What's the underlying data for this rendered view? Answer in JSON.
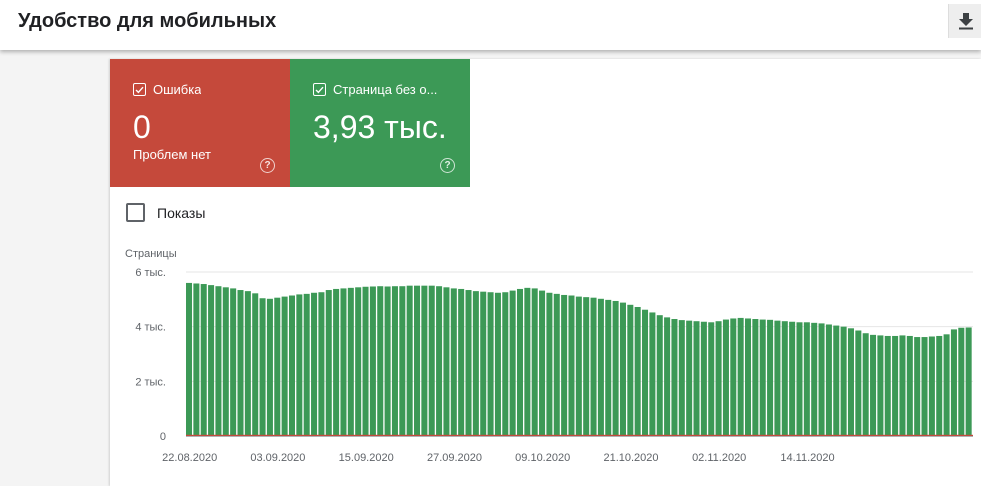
{
  "header": {
    "title": "Удобство для мобильных",
    "download_icon": "download-icon"
  },
  "tiles": {
    "error": {
      "label": "Ошибка",
      "value": "0",
      "sub": "Проблем нет",
      "color": "#c5493b",
      "checked": true
    },
    "valid": {
      "label": "Страница без о...",
      "value": "3,93 тыс.",
      "color": "#3c9956",
      "checked": true
    }
  },
  "impressions": {
    "label": "Показы",
    "checked": false
  },
  "chart_data": {
    "type": "bar",
    "ylabel": "Страницы",
    "ylim": [
      0,
      6000
    ],
    "yticks": [
      "0",
      "2 тыс.",
      "4 тыс.",
      "6 тыс."
    ],
    "ytick_values": [
      0,
      2000,
      4000,
      6000
    ],
    "xtick_labels": [
      "22.08.2020",
      "03.09.2020",
      "15.09.2020",
      "27.09.2020",
      "09.10.2020",
      "21.10.2020",
      "02.11.2020",
      "14.11.2020"
    ],
    "x_start": "22.08.2020",
    "grid": true,
    "series": [
      {
        "color": "#3c9956",
        "values": [
          5600,
          5580,
          5560,
          5520,
          5480,
          5440,
          5400,
          5340,
          5300,
          5220,
          5040,
          5020,
          5060,
          5100,
          5140,
          5180,
          5200,
          5240,
          5260,
          5340,
          5380,
          5400,
          5420,
          5440,
          5460,
          5470,
          5480,
          5470,
          5480,
          5480,
          5500,
          5500,
          5500,
          5500,
          5480,
          5440,
          5400,
          5380,
          5340,
          5300,
          5280,
          5260,
          5240,
          5260,
          5320,
          5380,
          5420,
          5400,
          5320,
          5240,
          5200,
          5160,
          5140,
          5100,
          5080,
          5060,
          5020,
          4980,
          4940,
          4880,
          4800,
          4720,
          4620,
          4520,
          4420,
          4340,
          4280,
          4240,
          4220,
          4200,
          4180,
          4160,
          4200,
          4260,
          4300,
          4320,
          4300,
          4280,
          4260,
          4250,
          4220,
          4200,
          4180,
          4160,
          4160,
          4140,
          4120,
          4080,
          4040,
          4000,
          3940,
          3860,
          3760,
          3700,
          3680,
          3660,
          3660,
          3680,
          3660,
          3620,
          3620,
          3640,
          3660,
          3720,
          3900,
          3960,
          3970
        ]
      },
      {
        "color": "#c5493b",
        "values": [
          0,
          0,
          0,
          0,
          0,
          0,
          0,
          0,
          0,
          0,
          0,
          0,
          0,
          0,
          0,
          0,
          0,
          0,
          0,
          0,
          0,
          0,
          0,
          0,
          0,
          0,
          0,
          0,
          0,
          0,
          0,
          0,
          0,
          0,
          0,
          0,
          0,
          0,
          0,
          0,
          0,
          0,
          0,
          0,
          0,
          0,
          0,
          0,
          0,
          0,
          0,
          0,
          0,
          0,
          0,
          0,
          0,
          0,
          0,
          0,
          0,
          0,
          0,
          0,
          0,
          0,
          0,
          0,
          0,
          0,
          0,
          0,
          0,
          0,
          0,
          0,
          0,
          0,
          0,
          0,
          0,
          0,
          0,
          0,
          0,
          0,
          0,
          0,
          0,
          0,
          0,
          0,
          0,
          0,
          0,
          0,
          0,
          0,
          0,
          0,
          0,
          0,
          0,
          0,
          0,
          0,
          0
        ]
      }
    ]
  }
}
